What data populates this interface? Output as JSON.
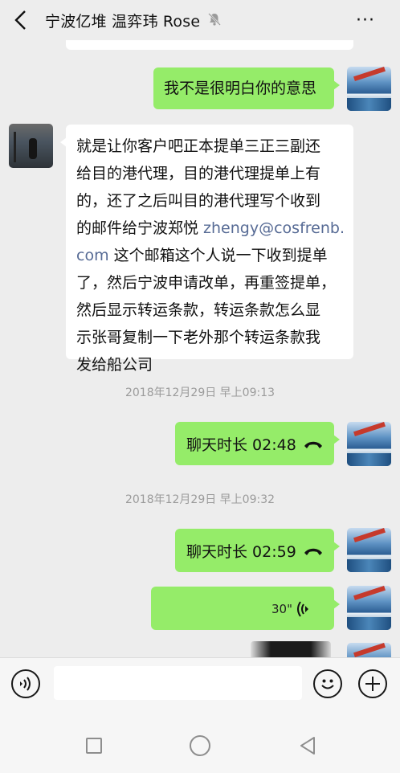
{
  "header": {
    "title": "宁波亿堆 温弈玮 Rose",
    "back_icon": "chevron-left-icon",
    "mute_icon": "bell-off-icon",
    "more_label": "···"
  },
  "messages": [
    {
      "sender": "me",
      "type": "text",
      "text": "我不是很明白你的意思"
    },
    {
      "sender": "other",
      "type": "text",
      "lines": [
        "就是让你客户吧正本提单三正三副还",
        "给目的港代理，目的港代理提单上有",
        "的，还了之后叫目的港代理写个收到",
        "的邮件给宁波郑悦 ",
        "com",
        " 这个邮箱这个人说一下收到提单",
        "了，然后宁波申请改单，再重签提单，",
        "然后显示转运条款，转运条款怎么显",
        "示张哥复制一下老外那个转运条款我",
        "发给船公司"
      ],
      "email_part1": "zhengy@cosfrenb.",
      "email_part2": "com"
    },
    {
      "sender": "system",
      "type": "time",
      "text": "2018年12月29日 早上09:13"
    },
    {
      "sender": "me",
      "type": "call",
      "text": "聊天时长 02:48"
    },
    {
      "sender": "system",
      "type": "time",
      "text": "2018年12月29日 早上09:32"
    },
    {
      "sender": "me",
      "type": "call",
      "text": "聊天时长 02:59"
    },
    {
      "sender": "me",
      "type": "voice",
      "duration": "30\""
    }
  ],
  "input": {
    "value": "",
    "placeholder": ""
  },
  "colors": {
    "bubble_me": "#95ec69",
    "bubble_other": "#ffffff",
    "link": "#576b95",
    "background": "#ededed"
  }
}
